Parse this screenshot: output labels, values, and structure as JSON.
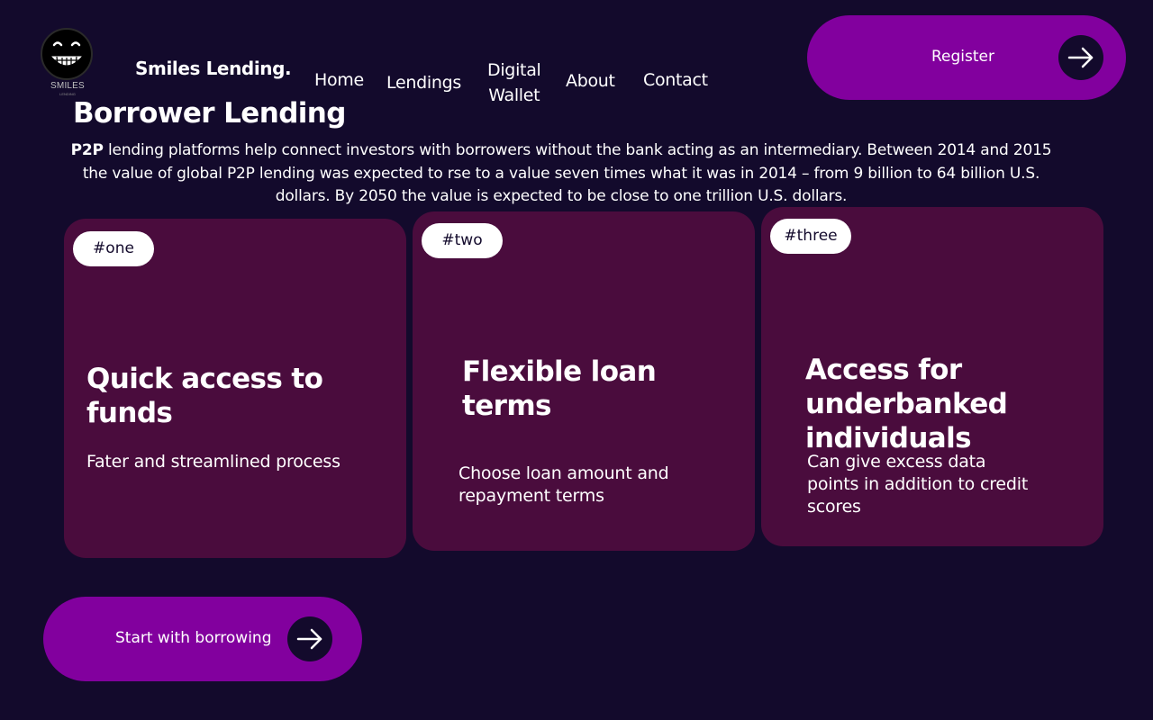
{
  "colors": {
    "background": "#130a2c",
    "accent": "#82009e",
    "card": "#4a0c3d",
    "text": "#ffffff",
    "tag_bg": "#ffffff"
  },
  "logo": {
    "icon": "grinning-face-icon",
    "text": "SMILES",
    "subtext": "LENDING"
  },
  "brand": {
    "name": "Smiles Lending."
  },
  "nav": {
    "items": [
      {
        "label": "Home"
      },
      {
        "label": "Lendings"
      },
      {
        "label": "Digital Wallet",
        "line1": "Digital",
        "line2": "Wallet"
      },
      {
        "label": "About"
      },
      {
        "label": "Contact"
      }
    ]
  },
  "register": {
    "label": "Register",
    "icon": "arrow-right-icon"
  },
  "section": {
    "title": "Borrower Lending",
    "intro_bold": "P2P",
    "intro_rest": " lending platforms help connect investors with borrowers without the bank acting as an intermediary. Between 2014 and 2015 the value of global P2P lending was expected to rse to a value seven times what it was in 2014 – from 9 billion to 64 billion U.S. dollars. By 2050 the value is expected to be close to one trillion U.S. dollars."
  },
  "cards": [
    {
      "tag": "#one",
      "title": "Quick access to funds",
      "description": "Fater and streamlined process"
    },
    {
      "tag": "#two",
      "title": "Flexible loan terms",
      "description": "Choose loan amount and repayment terms"
    },
    {
      "tag": "#three",
      "title": "Access for underbanked individuals",
      "description": "Can give excess data points in addition to credit scores"
    }
  ],
  "start": {
    "label": "Start with borrowing",
    "icon": "arrow-right-icon"
  }
}
